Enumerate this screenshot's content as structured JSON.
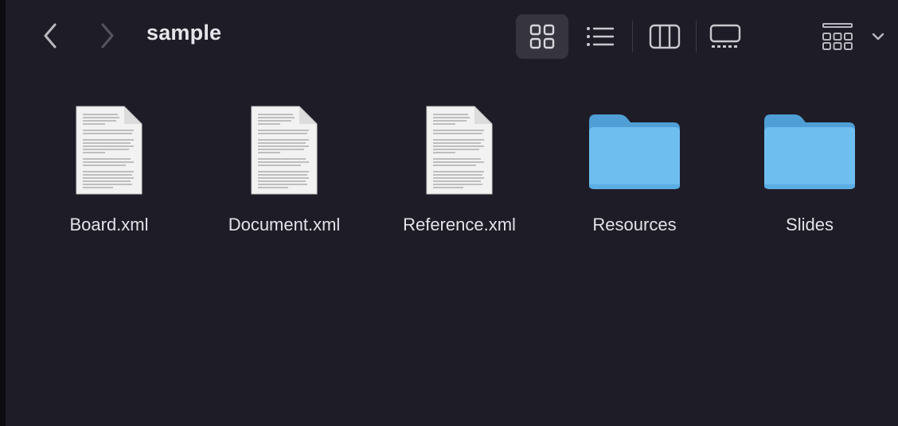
{
  "window": {
    "title": "sample"
  },
  "toolbar": {
    "back_icon": "chevron-left-icon",
    "forward_icon": "chevron-right-icon",
    "views": [
      {
        "name": "icon-view",
        "icon": "grid-icon",
        "active": true
      },
      {
        "name": "list-view",
        "icon": "list-icon",
        "active": false
      },
      {
        "name": "column-view",
        "icon": "columns-icon",
        "active": false
      },
      {
        "name": "gallery-view",
        "icon": "gallery-icon",
        "active": false
      }
    ],
    "group_icon": "group-grid-icon"
  },
  "files": [
    {
      "name": "Board.xml",
      "kind": "document"
    },
    {
      "name": "Document.xml",
      "kind": "document"
    },
    {
      "name": "Reference.xml",
      "kind": "document"
    },
    {
      "name": "Resources",
      "kind": "folder"
    },
    {
      "name": "Slides",
      "kind": "folder"
    }
  ],
  "colors": {
    "background": "#1e1c26",
    "folder": "#6fbef0",
    "text": "#e3e2e8"
  }
}
